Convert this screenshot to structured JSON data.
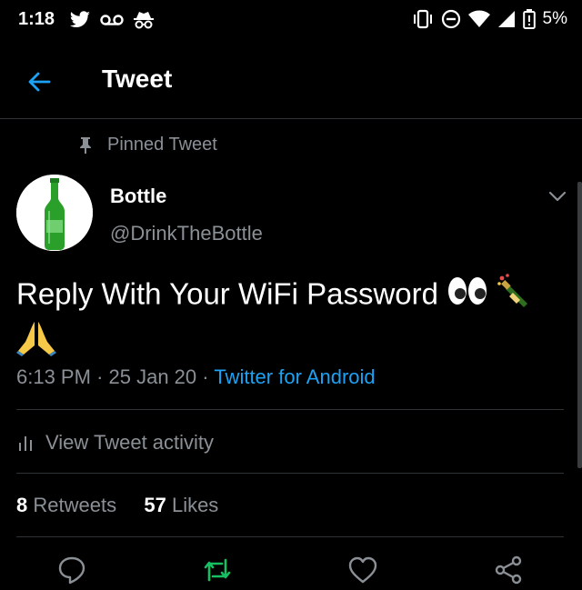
{
  "status_bar": {
    "time": "1:18",
    "battery_percent": "5%",
    "icons": [
      "twitter-bird-icon",
      "voicemail-icon",
      "incognito-icon",
      "vibrate-icon",
      "do-not-disturb-icon",
      "wifi-icon",
      "cell-signal-icon",
      "battery-icon"
    ]
  },
  "header": {
    "title": "Tweet",
    "back_icon": "arrow-left-icon"
  },
  "tweet": {
    "pinned_label": "Pinned Tweet",
    "author_name": "Bottle",
    "author_handle": "@DrinkTheBottle",
    "text": "Reply With Your WiFi Password",
    "emojis": [
      "eyes-emoji",
      "champagne-emoji",
      "folded-hands-emoji"
    ],
    "time": "6:13 PM",
    "date": "25 Jan 20",
    "separator": "·",
    "source": "Twitter for Android",
    "activity_label": "View Tweet activity",
    "retweets_count": "8",
    "retweets_label": "Retweets",
    "likes_count": "57",
    "likes_label": "Likes"
  },
  "actions": [
    "reply-icon",
    "retweet-icon",
    "like-icon",
    "share-icon"
  ],
  "colors": {
    "background": "#000000",
    "accent": "#1da1f2",
    "secondary_text": "#8b9096",
    "retweet_green": "#17bf63",
    "divider": "#2f3336"
  }
}
